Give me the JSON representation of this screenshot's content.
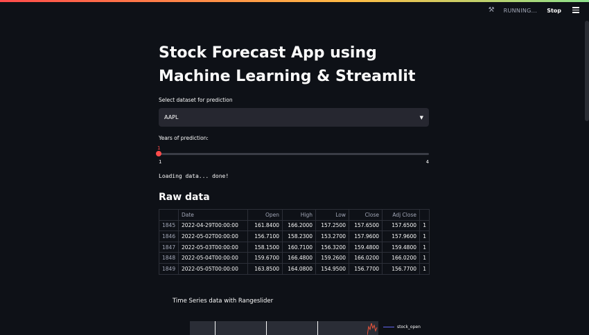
{
  "status": {
    "running_icon": "running-figure-icon",
    "running_text": "RUNNING...",
    "stop_label": "Stop",
    "menu_icon": "hamburger-menu-icon"
  },
  "title": "Stock Forecast App using Machine Learning & Streamlit",
  "dataset_select": {
    "label": "Select dataset for prediction",
    "value": "AAPL"
  },
  "years_slider": {
    "label": "Years of prediction:",
    "value": "1",
    "min": "1",
    "max": "4"
  },
  "loading_text": "Loading data... done!",
  "raw_section": {
    "heading": "Raw data",
    "columns": [
      "",
      "Date",
      "Open",
      "High",
      "Low",
      "Close",
      "Adj Close",
      ""
    ],
    "rows": [
      [
        "1845",
        "2022-04-29T00:00:00",
        "161.8400",
        "166.2000",
        "157.2500",
        "157.6500",
        "157.6500",
        "1"
      ],
      [
        "1846",
        "2022-05-02T00:00:00",
        "156.7100",
        "158.2300",
        "153.2700",
        "157.9600",
        "157.9600",
        "1"
      ],
      [
        "1847",
        "2022-05-03T00:00:00",
        "158.1500",
        "160.7100",
        "156.3200",
        "159.4800",
        "159.4800",
        "1"
      ],
      [
        "1848",
        "2022-05-04T00:00:00",
        "159.6700",
        "166.4800",
        "159.2600",
        "166.0200",
        "166.0200",
        "1"
      ],
      [
        "1849",
        "2022-05-05T00:00:00",
        "163.8500",
        "164.0800",
        "154.9500",
        "156.7700",
        "156.7700",
        "1"
      ]
    ]
  },
  "chart": {
    "title": "Time Series data with Rangeslider",
    "legend": "stock_open",
    "series_color": "#6366f1"
  },
  "colors": {
    "accent": "#ff4b4b",
    "background": "#0e1117",
    "widget_bg": "#262730"
  }
}
